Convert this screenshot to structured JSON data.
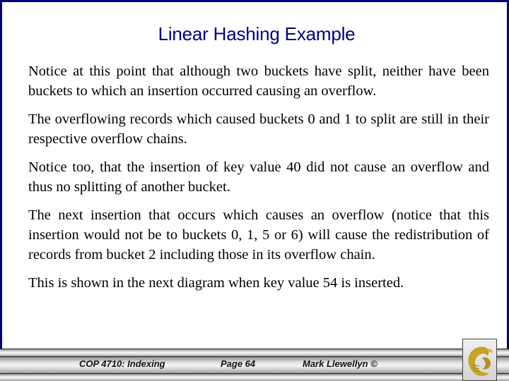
{
  "slide": {
    "title": "Linear Hashing Example",
    "paragraphs": [
      "Notice at this point that although two buckets have split, neither have been buckets to which an insertion occurred causing an overflow.",
      "The overflowing records which caused buckets 0 and 1 to split are still in their respective overflow chains.",
      "Notice too, that the insertion of key value 40 did not cause an overflow and thus no splitting of another bucket.",
      "The next insertion that occurs which causes an overflow (notice that this insertion would not be to buckets 0, 1, 5 or 6) will cause the redistribution of records from bucket 2 including those in its overflow chain.",
      "This is shown in the next diagram when key value 54 is inserted."
    ]
  },
  "footer": {
    "course": "COP 4710: Indexing",
    "page": "Page 64",
    "author": "Mark Llewellyn ©",
    "logo_icon": "pegasus-logo-icon"
  },
  "colors": {
    "title": "#000080",
    "border": "#000080",
    "logo_gold": "#C9A227"
  }
}
